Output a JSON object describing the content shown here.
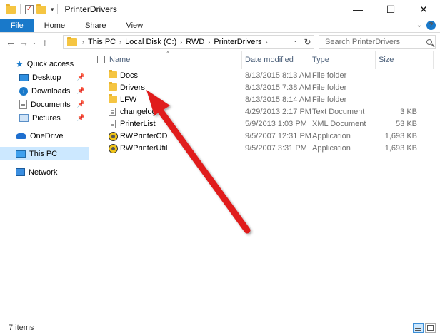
{
  "window": {
    "title": "PrinterDrivers",
    "minimize": "—",
    "maximize": "☐",
    "close": "✕"
  },
  "ribbon": {
    "tabs": [
      "File",
      "Home",
      "Share",
      "View"
    ],
    "expand": "⌄",
    "help": "?"
  },
  "nav": {
    "back": "←",
    "forward": "→",
    "recent": "⌄",
    "up": "↑",
    "breadcrumb": [
      "This PC",
      "Local Disk (C:)",
      "RWD",
      "PrinterDrivers"
    ],
    "search_placeholder": "Search PrinterDrivers"
  },
  "sidebar": {
    "quick_access": "Quick access",
    "items": [
      {
        "label": "Desktop",
        "icon": "desktop-icon"
      },
      {
        "label": "Downloads",
        "icon": "downloads-icon"
      },
      {
        "label": "Documents",
        "icon": "documents-icon"
      },
      {
        "label": "Pictures",
        "icon": "pictures-icon"
      }
    ],
    "onedrive": "OneDrive",
    "thispc": "This PC",
    "network": "Network"
  },
  "columns": {
    "name": "Name",
    "date": "Date modified",
    "type": "Type",
    "size": "Size"
  },
  "files": [
    {
      "name": "Docs",
      "date": "8/13/2015 8:13 AM",
      "type": "File folder",
      "size": "",
      "icon": "folder-icon"
    },
    {
      "name": "Drivers",
      "date": "8/13/2015 7:38 AM",
      "type": "File folder",
      "size": "",
      "icon": "folder-icon"
    },
    {
      "name": "LFW",
      "date": "8/13/2015 8:14 AM",
      "type": "File folder",
      "size": "",
      "icon": "folder-icon"
    },
    {
      "name": "changelog",
      "date": "4/29/2013 2:17 PM",
      "type": "Text Document",
      "size": "3 KB",
      "icon": "text-document-icon"
    },
    {
      "name": "PrinterList",
      "date": "5/9/2013 1:03 PM",
      "type": "XML Document",
      "size": "53 KB",
      "icon": "xml-document-icon"
    },
    {
      "name": "RWPrinterCD",
      "date": "9/5/2007 12:31 PM",
      "type": "Application",
      "size": "1,693 KB",
      "icon": "application-icon"
    },
    {
      "name": "RWPrinterUtil",
      "date": "9/5/2007 3:31 PM",
      "type": "Application",
      "size": "1,693 KB",
      "icon": "application-icon"
    }
  ],
  "status": {
    "item_count": "7 items"
  },
  "colors": {
    "accent": "#1979ca",
    "selection": "#cce8ff",
    "annotation_arrow": "#e01e1e"
  }
}
